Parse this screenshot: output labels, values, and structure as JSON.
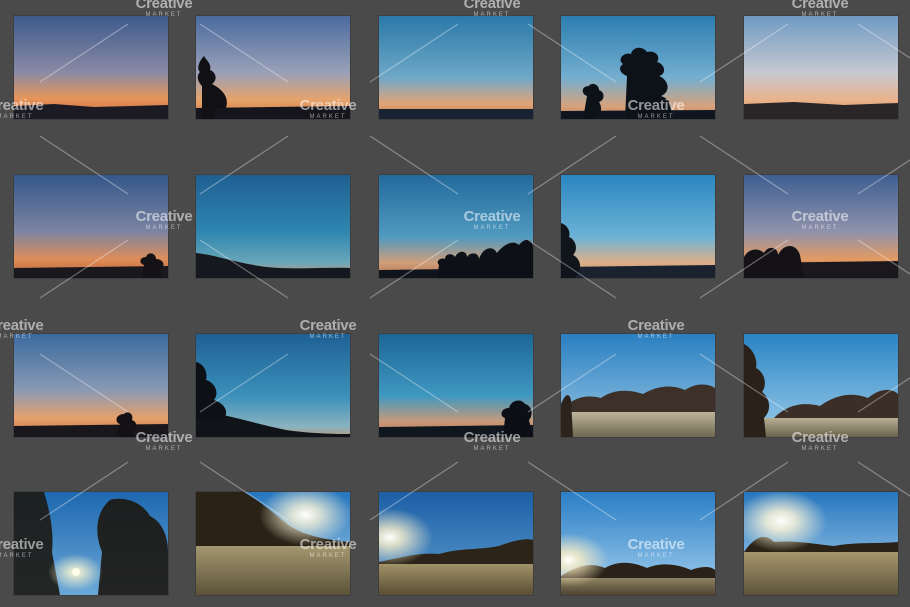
{
  "watermark": {
    "brand": "Creative",
    "sub": "MARKET"
  },
  "colors": {
    "background": "#4a4a4a"
  },
  "photos": [
    {
      "id": "p1",
      "scene": "dusk-gradient-plain"
    },
    {
      "id": "p2",
      "scene": "dusk-gradient-left-tree"
    },
    {
      "id": "p3",
      "scene": "blue-horizon-plain"
    },
    {
      "id": "p4",
      "scene": "blue-horizon-trees"
    },
    {
      "id": "p5",
      "scene": "pale-dusk-plain"
    },
    {
      "id": "p6",
      "scene": "dusk-gradient-small-tree"
    },
    {
      "id": "p7",
      "scene": "blue-hill-silhouette"
    },
    {
      "id": "p8",
      "scene": "blue-treeline-right"
    },
    {
      "id": "p9",
      "scene": "blue-left-tree"
    },
    {
      "id": "p10",
      "scene": "dusk-treeline-left"
    },
    {
      "id": "p11",
      "scene": "dusk-small-tree"
    },
    {
      "id": "p12",
      "scene": "blue-hill-tree"
    },
    {
      "id": "p13",
      "scene": "blue-right-tree"
    },
    {
      "id": "p14",
      "scene": "frost-field-forest"
    },
    {
      "id": "p15",
      "scene": "frost-field-left-tree"
    },
    {
      "id": "p16",
      "scene": "bare-trees-sun"
    },
    {
      "id": "p17",
      "scene": "field-sunburst"
    },
    {
      "id": "p18",
      "scene": "field-sun-left"
    },
    {
      "id": "p19",
      "scene": "field-low-sun"
    },
    {
      "id": "p20",
      "scene": "field-sunburst-right"
    }
  ]
}
